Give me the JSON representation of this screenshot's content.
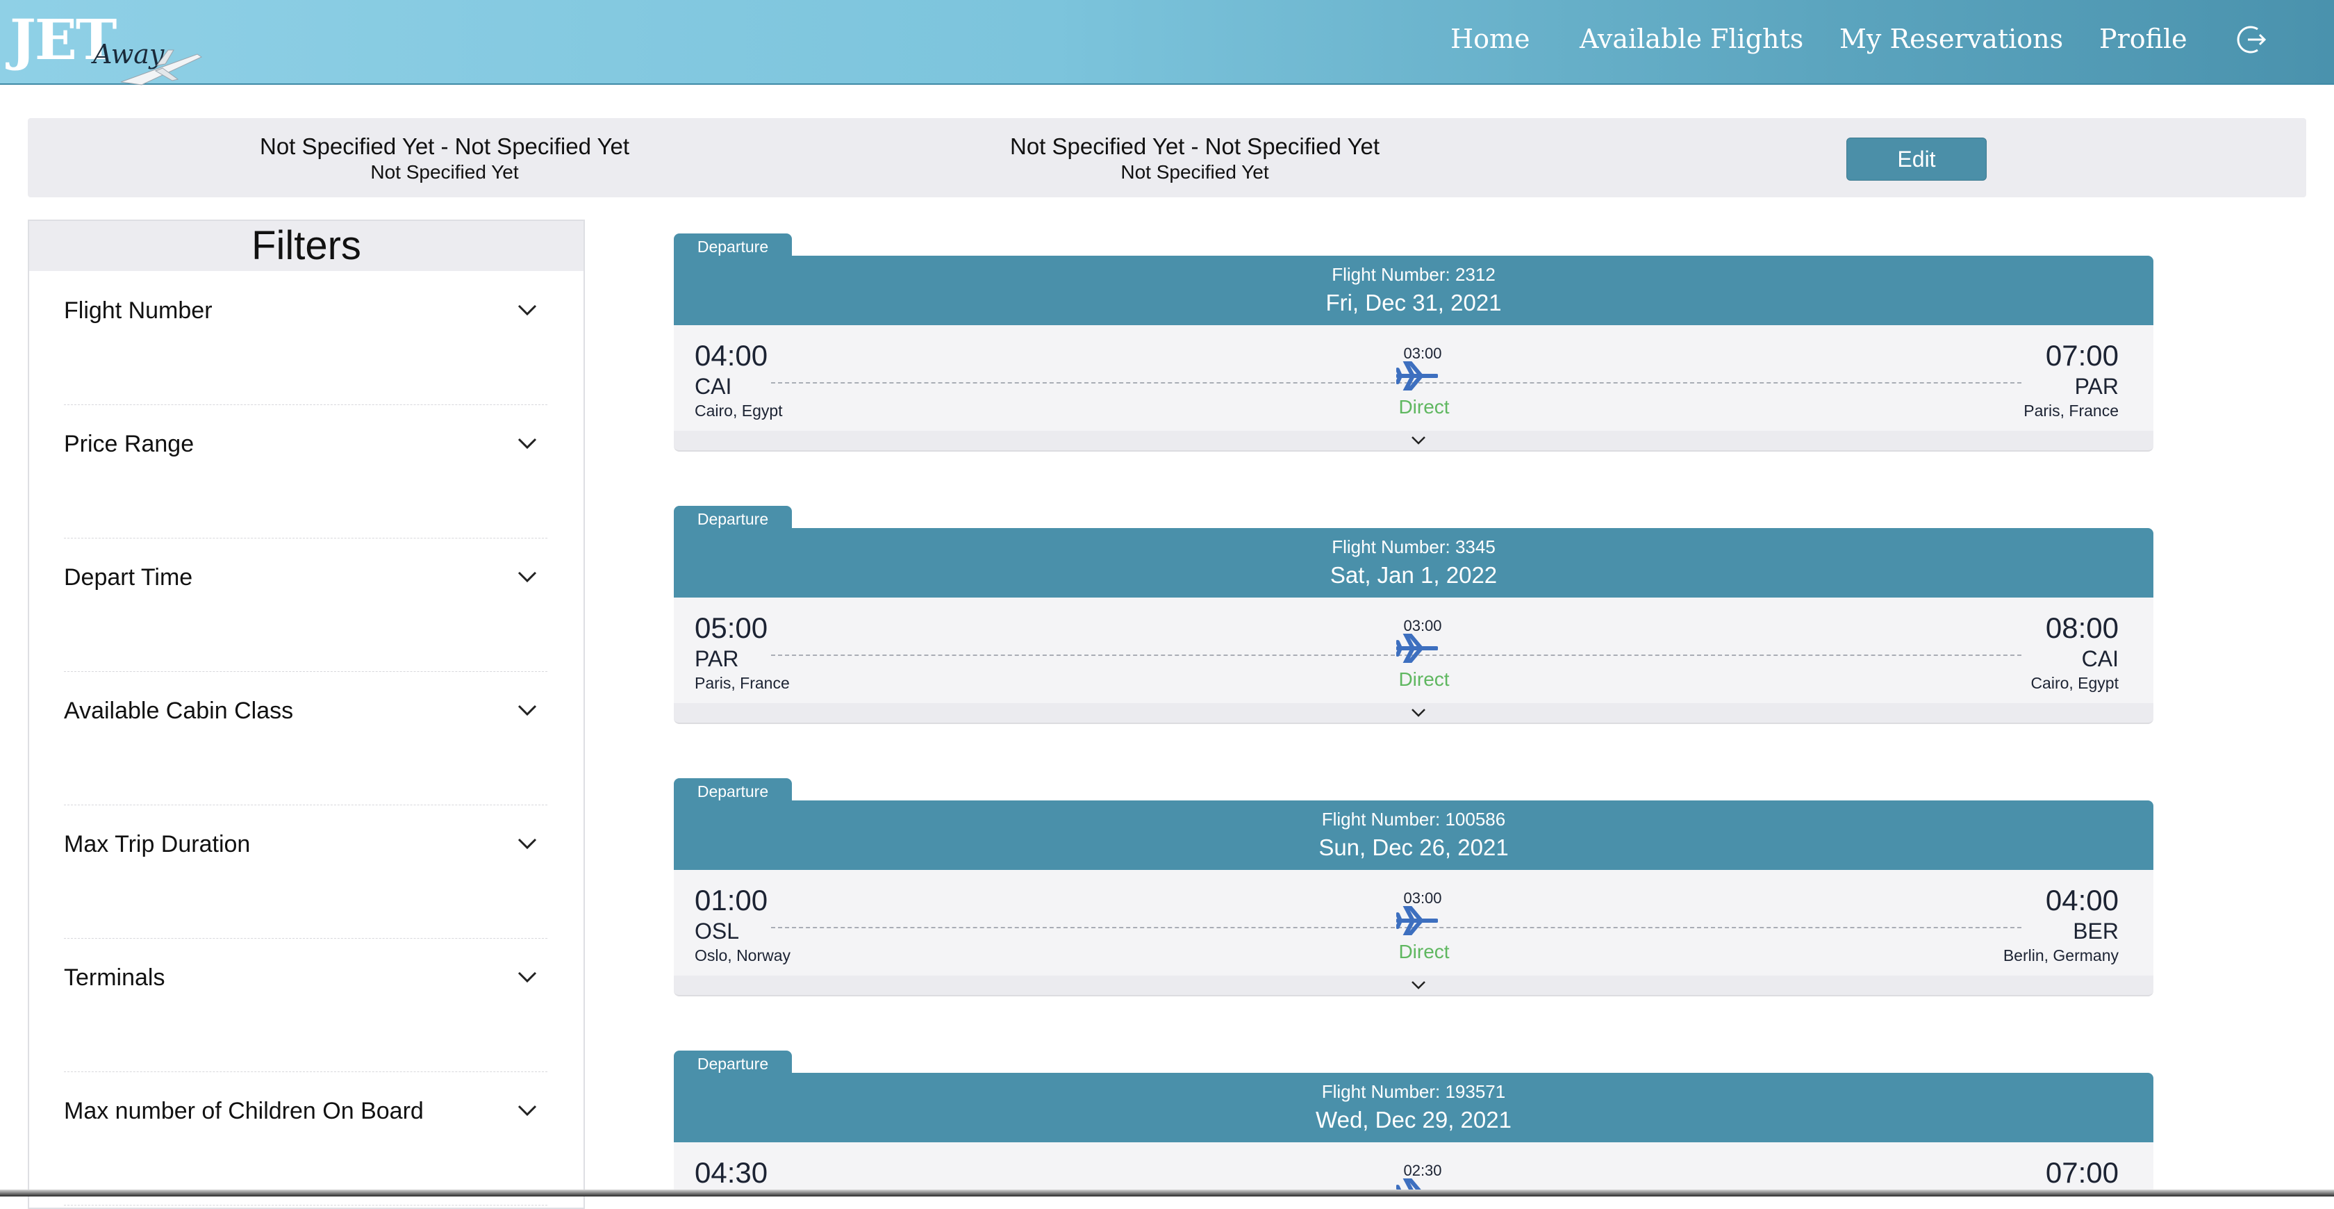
{
  "brand": {
    "name_main": "JET",
    "name_sub": "Away"
  },
  "nav": {
    "links": [
      "Home",
      "Available Flights",
      "My Reservations",
      "Profile"
    ],
    "logout_icon": "logout-icon"
  },
  "search_summary": {
    "outbound": {
      "route": "Not Specified Yet - Not Specified Yet",
      "date": "Not Specified Yet"
    },
    "return": {
      "route": "Not Specified Yet - Not Specified Yet",
      "date": "Not Specified Yet"
    },
    "edit_label": "Edit"
  },
  "filters": {
    "title": "Filters",
    "items": [
      "Flight Number",
      "Price Range",
      "Depart Time",
      "Available Cabin Class",
      "Max Trip Duration",
      "Terminals",
      "Max number of Children On Board"
    ]
  },
  "flights": [
    {
      "tag": "Departure",
      "flight_number": "Flight Number: 2312",
      "date": "Fri, Dec 31, 2021",
      "dep_time": "04:00",
      "dep_code": "CAI",
      "dep_city": "Cairo, Egypt",
      "arr_time": "07:00",
      "arr_code": "PAR",
      "arr_city": "Paris, France",
      "duration": "03:00",
      "stops": "Direct"
    },
    {
      "tag": "Departure",
      "flight_number": "Flight Number: 3345",
      "date": "Sat, Jan 1, 2022",
      "dep_time": "05:00",
      "dep_code": "PAR",
      "dep_city": "Paris, France",
      "arr_time": "08:00",
      "arr_code": "CAI",
      "arr_city": "Cairo, Egypt",
      "duration": "03:00",
      "stops": "Direct"
    },
    {
      "tag": "Departure",
      "flight_number": "Flight Number: 100586",
      "date": "Sun, Dec 26, 2021",
      "dep_time": "01:00",
      "dep_code": "OSL",
      "dep_city": "Oslo, Norway",
      "arr_time": "04:00",
      "arr_code": "BER",
      "arr_city": "Berlin, Germany",
      "duration": "03:00",
      "stops": "Direct"
    },
    {
      "tag": "Departure",
      "flight_number": "Flight Number: 193571",
      "date": "Wed, Dec 29, 2021",
      "dep_time": "04:30",
      "dep_code": "",
      "dep_city": "",
      "arr_time": "07:00",
      "arr_code": "",
      "arr_city": "",
      "duration": "02:30",
      "stops": ""
    }
  ],
  "colors": {
    "accent": "#4a90aa",
    "direct": "#5fb760",
    "plane": "#3d6fbf",
    "edit_button": "#4b8fa8"
  }
}
